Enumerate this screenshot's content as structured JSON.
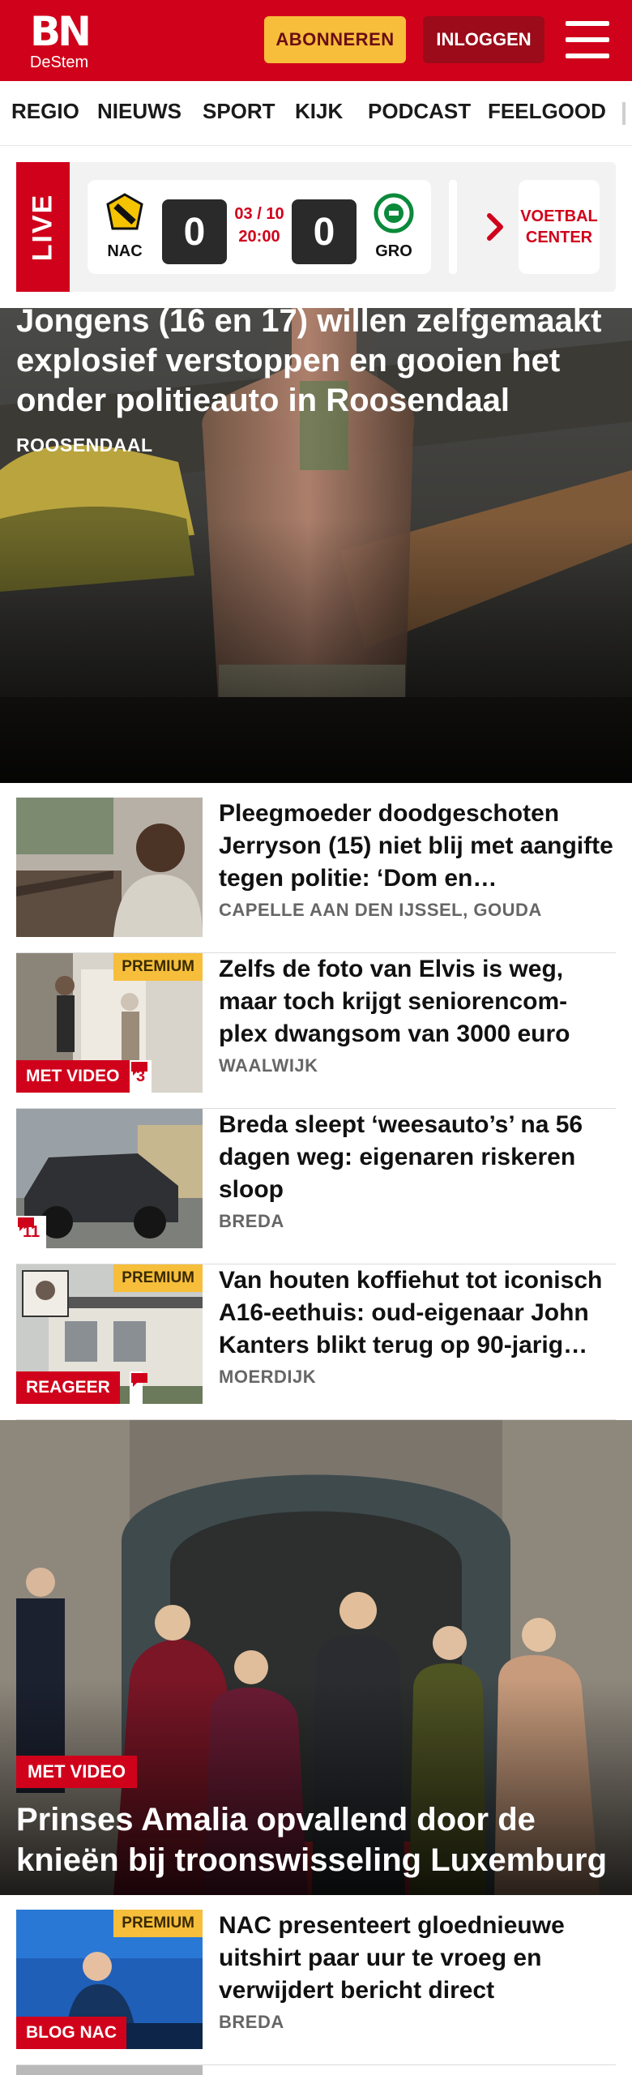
{
  "header": {
    "logo_main": "BN",
    "logo_sub": "DeStem",
    "subscribe_label": "ABONNEREN",
    "login_label": "INLOGGEN",
    "brand_color": "#d0021b",
    "accent_color": "#f6be3a"
  },
  "nav": {
    "items": [
      "REGIO",
      "NIEUWS",
      "SPORT",
      "KIJK",
      "PODCAST",
      "FEELGOOD"
    ]
  },
  "live": {
    "label": "LIVE",
    "home_team": "NAC",
    "away_team": "GRO",
    "home_score": "0",
    "away_score": "0",
    "date": "03 / 10",
    "time": "20:00",
    "center_label_1": "VOETBAL",
    "center_label_2": "CENTER"
  },
  "hero": {
    "title": "Jongens (16 en 17) willen zelfgemaakt explosief verstoppen en gooien het onder politieauto in Roosendaal",
    "location": "ROOSENDAAL"
  },
  "articles": [
    {
      "title": "Pleegmoeder doodgeschoten Jerryson (15) niet blij met aangifte tegen politie: ‘Dom en…",
      "location": "CAPELLE AAN DEN IJSSEL, GOUDA"
    },
    {
      "title": "Zelfs de foto van Elvis is weg, maar toch krijgt seniorencom-plex dwangsom van 3000 euro",
      "location": "WAALWIJK",
      "premium": "PREMIUM",
      "label": "MET VIDEO",
      "comments": "3"
    },
    {
      "title": "Breda sleept ‘weesauto’s’ na 56 dagen weg: eigenaren riskeren sloop",
      "location": "BREDA",
      "comments": "11"
    },
    {
      "title": "Van houten koffiehut tot iconisch A16-eethuis: oud-eigenaar John Kanters blikt terug op 90-jarig…",
      "location": "MOERDIJK",
      "premium": "PREMIUM",
      "label": "REAGEER"
    }
  ],
  "feature": {
    "label": "MET VIDEO",
    "title": "Prinses Amalia opvallend door de knieën bij troonswisseling Luxemburg"
  },
  "article_last": {
    "title": "NAC presenteert gloednieuwe uitshirt paar uur te vroeg en verwijdert bericht direct",
    "location": "BREDA",
    "premium": "PREMIUM",
    "label": "BLOG NAC"
  }
}
